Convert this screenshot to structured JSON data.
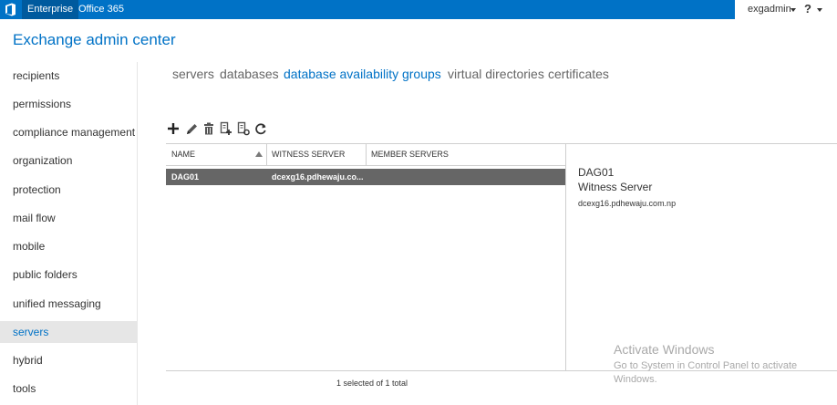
{
  "topbar": {
    "enterprise_label": "Enterprise",
    "office365_label": "Office 365",
    "user_label": "exgadmin",
    "help_label": "?"
  },
  "app_title": "Exchange admin center",
  "leftnav": {
    "items": [
      {
        "label": "recipients"
      },
      {
        "label": "permissions"
      },
      {
        "label": "compliance management"
      },
      {
        "label": "organization"
      },
      {
        "label": "protection"
      },
      {
        "label": "mail flow"
      },
      {
        "label": "mobile"
      },
      {
        "label": "public folders"
      },
      {
        "label": "unified messaging"
      },
      {
        "label": "servers",
        "active": true
      },
      {
        "label": "hybrid"
      },
      {
        "label": "tools"
      }
    ]
  },
  "tabs": [
    {
      "label": "servers"
    },
    {
      "label": "databases"
    },
    {
      "label": "database availability groups",
      "active": true
    },
    {
      "label": "virtual directories"
    },
    {
      "label": "certificates"
    }
  ],
  "toolbar": {
    "icons": [
      "add-icon",
      "edit-icon",
      "delete-icon",
      "manage-membership-icon",
      "manage-network-icon",
      "refresh-icon"
    ]
  },
  "grid": {
    "columns": [
      "NAME",
      "WITNESS SERVER",
      "MEMBER SERVERS"
    ],
    "rows": [
      {
        "name": "DAG01",
        "witness_server": "dcexg16.pdhewaju.co...",
        "member_servers": ""
      }
    ],
    "status": "1 selected of 1 total"
  },
  "details": {
    "title": "DAG01",
    "subtitle": "Witness Server",
    "value": "dcexg16.pdhewaju.com.np"
  },
  "watermark": {
    "title": "Activate Windows",
    "line": "Go to System in Control Panel to activate Windows."
  },
  "colors": {
    "brand": "#0072c6",
    "selected_row": "#666666",
    "nav_active_bg": "#e6e6e6"
  }
}
